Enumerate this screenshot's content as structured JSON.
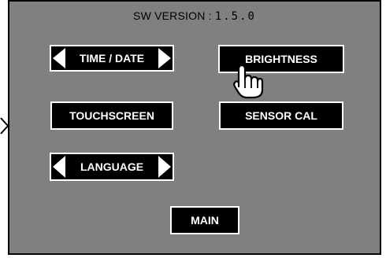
{
  "header": {
    "version_label": "SW VERSION :",
    "version_number": "1.5.0"
  },
  "buttons": {
    "time_date": "TIME / DATE",
    "brightness": "BRIGHTNESS",
    "touchscreen": "TOUCHSCREEN",
    "sensor_cal": "SENSOR CAL",
    "language": "LANGUAGE",
    "main": "MAIN"
  },
  "icons": {
    "cursor": "hand-pointer-icon",
    "arrow_left": "triangle-left-icon",
    "arrow_right": "triangle-right-icon",
    "edge_arrow": "chevron-right-icon"
  },
  "colors": {
    "background": "#808080",
    "button_fill": "#000000",
    "button_text": "#ffffff"
  }
}
